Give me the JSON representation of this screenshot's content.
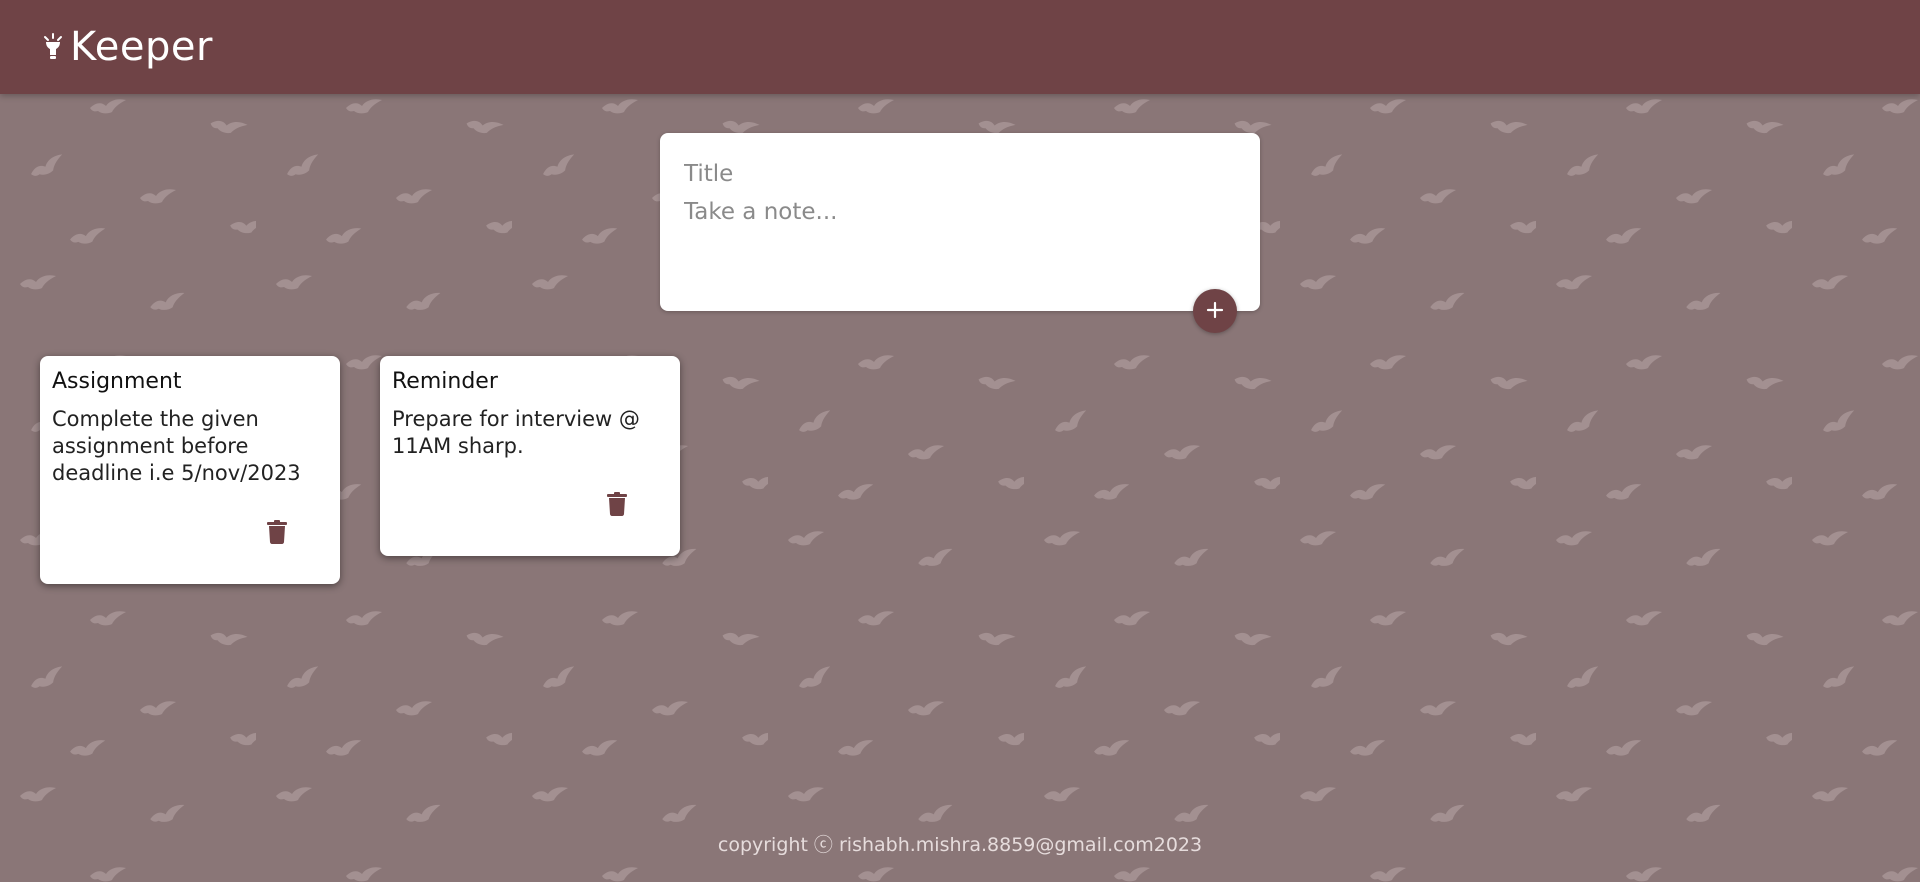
{
  "app": {
    "title": "Keeper"
  },
  "composer": {
    "title_placeholder": "Title",
    "content_placeholder": "Take a note...",
    "add_icon": "plus-icon"
  },
  "notes": [
    {
      "title": "Assignment",
      "content": "Complete the given assignment before deadline i.e 5/nov/2023",
      "delete_icon": "trash-icon"
    },
    {
      "title": "Reminder",
      "content": "Prepare for interview @ 11AM sharp.",
      "delete_icon": "trash-icon"
    }
  ],
  "footer": {
    "text": "copyright ⓒ rishabh.mishra.8859@gmail.com2023"
  },
  "colors": {
    "header_bg": "#6f4346",
    "page_bg": "#8a7677",
    "accent": "#6f4346",
    "card_bg": "#ffffff"
  }
}
